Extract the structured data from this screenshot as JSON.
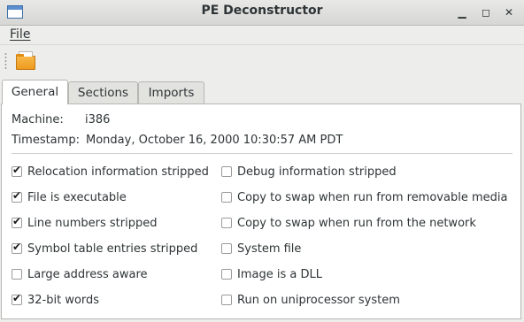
{
  "window": {
    "title": "PE Deconstructor"
  },
  "menu": {
    "file_label": "File"
  },
  "toolbar": {
    "open_icon": "folder-open-icon"
  },
  "tabs": [
    {
      "label": "General",
      "active": true
    },
    {
      "label": "Sections",
      "active": false
    },
    {
      "label": "Imports",
      "active": false
    }
  ],
  "general": {
    "machine_label": "Machine:",
    "machine_value": "i386",
    "timestamp_label": "Timestamp:",
    "timestamp_value": "Monday, October 16, 2000 10:30:57 AM PDT"
  },
  "flags_left": [
    {
      "label": "Relocation information stripped",
      "checked": true
    },
    {
      "label": "File is executable",
      "checked": true
    },
    {
      "label": "Line numbers stripped",
      "checked": true
    },
    {
      "label": "Symbol table entries stripped",
      "checked": true
    },
    {
      "label": "Large address aware",
      "checked": false
    },
    {
      "label": "32-bit words",
      "checked": true
    }
  ],
  "flags_right": [
    {
      "label": "Debug information stripped",
      "checked": false
    },
    {
      "label": "Copy to swap when run from removable media",
      "checked": false
    },
    {
      "label": "Copy to swap when run from the network",
      "checked": false
    },
    {
      "label": "System file",
      "checked": false
    },
    {
      "label": "Image is a DLL",
      "checked": false
    },
    {
      "label": "Run on uniprocessor system",
      "checked": false
    }
  ]
}
